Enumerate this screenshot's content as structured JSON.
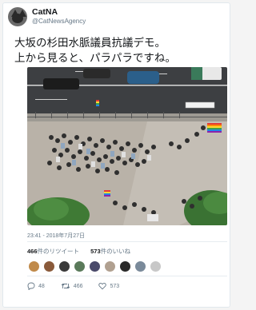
{
  "author": {
    "display_name": "CatNA",
    "handle": "@CatNewsAgency"
  },
  "tweet": {
    "text": "大坂の杉田水脈議員抗議デモ。\n上から見ると、パラパラですね。",
    "timestamp": "23:41 - 2018年7月27日"
  },
  "stats": {
    "retweets_count": "466",
    "retweets_label": "件のリツイート",
    "likes_count": "573",
    "likes_label": "件のいいね"
  },
  "likers": [
    "#c08a4a",
    "#8a5a3a",
    "#3a3a3a",
    "#5a7a5a",
    "#4a4a6a",
    "#b0a090",
    "#2a2a2a",
    "#7a8a9a",
    "#c8c8c8"
  ],
  "actions": {
    "reply_count": "48",
    "retweet_count": "466",
    "like_count": "573"
  },
  "colors": {
    "text": "#14171a",
    "muted": "#657786",
    "border": "#e1e8ed"
  }
}
